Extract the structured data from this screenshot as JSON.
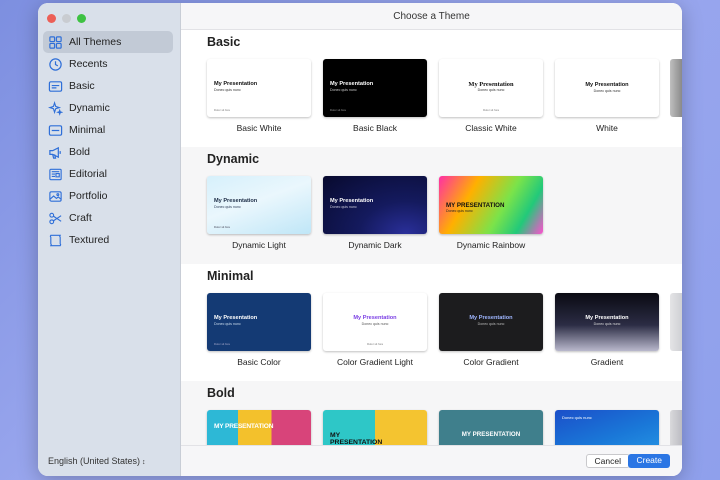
{
  "window": {
    "title": "Choose a Theme"
  },
  "sidebar": {
    "items": [
      {
        "label": "All Themes",
        "icon": "grid-icon",
        "active": true
      },
      {
        "label": "Recents",
        "icon": "clock-icon"
      },
      {
        "label": "Basic",
        "icon": "slide-lines-icon"
      },
      {
        "label": "Dynamic",
        "icon": "sparkles-icon"
      },
      {
        "label": "Minimal",
        "icon": "slide-minimal-icon"
      },
      {
        "label": "Bold",
        "icon": "megaphone-icon"
      },
      {
        "label": "Editorial",
        "icon": "newspaper-icon"
      },
      {
        "label": "Portfolio",
        "icon": "photo-icon"
      },
      {
        "label": "Craft",
        "icon": "scissors-icon"
      },
      {
        "label": "Textured",
        "icon": "textured-frame-icon"
      }
    ],
    "language": "English (United States)"
  },
  "sections": [
    {
      "title": "Basic",
      "themes": [
        {
          "name": "Basic White",
          "thumb_title": "My Presentation",
          "thumb_sub": "Donec quis nunc",
          "thumb_foot": "Dolor sit fora"
        },
        {
          "name": "Basic Black",
          "thumb_title": "My Presentation",
          "thumb_sub": "Donec quis nunc",
          "thumb_foot": "Dolor sit fora"
        },
        {
          "name": "Classic White",
          "thumb_title": "My Presentation",
          "thumb_sub": "Donec quis nunc",
          "thumb_foot": "Dolor sit fora"
        },
        {
          "name": "White",
          "thumb_title": "My Presentation",
          "thumb_sub": "Donec quis nunc",
          "thumb_foot": ""
        }
      ]
    },
    {
      "title": "Dynamic",
      "themes": [
        {
          "name": "Dynamic Light",
          "thumb_title": "My Presentation",
          "thumb_sub": "Donec quis nunc",
          "thumb_foot": "Dolor sit fora"
        },
        {
          "name": "Dynamic Dark",
          "thumb_title": "My Presentation",
          "thumb_sub": "Donec quis nunc",
          "thumb_foot": ""
        },
        {
          "name": "Dynamic Rainbow",
          "thumb_title": "MY PRESENTATION",
          "thumb_sub": "Donec quis nunc",
          "thumb_foot": ""
        }
      ]
    },
    {
      "title": "Minimal",
      "themes": [
        {
          "name": "Basic Color",
          "thumb_title": "My Presentation",
          "thumb_sub": "Donec quis nunc",
          "thumb_foot": "Dolor sit fora"
        },
        {
          "name": "Color Gradient Light",
          "thumb_title": "My Presentation",
          "thumb_sub": "Donec quis nunc",
          "thumb_foot": "Dolor sit fora"
        },
        {
          "name": "Color Gradient",
          "thumb_title": "My Presentation",
          "thumb_sub": "Donec quis nunc",
          "thumb_foot": ""
        },
        {
          "name": "Gradient",
          "thumb_title": "My Presentation",
          "thumb_sub": "Donec quis nunc",
          "thumb_foot": ""
        }
      ]
    },
    {
      "title": "Bold",
      "themes": [
        {
          "name": "",
          "thumb_title": "MY PRESENTATION",
          "thumb_sub": "",
          "thumb_foot": ""
        },
        {
          "name": "",
          "thumb_title": "MY PRESENTATION",
          "thumb_sub": "",
          "thumb_foot": ""
        },
        {
          "name": "",
          "thumb_title": "MY PRESENTATION",
          "thumb_sub": "",
          "thumb_foot": ""
        },
        {
          "name": "",
          "thumb_title": "",
          "thumb_sub": "Donec quis nunc",
          "thumb_foot": ""
        }
      ]
    }
  ],
  "footer": {
    "cancel_label": "Cancel",
    "create_label": "Create"
  },
  "colors": {
    "accent": "#2b76e4",
    "sidebar_bg": "#d9e0ea",
    "desktop": "#8fa0ec"
  }
}
